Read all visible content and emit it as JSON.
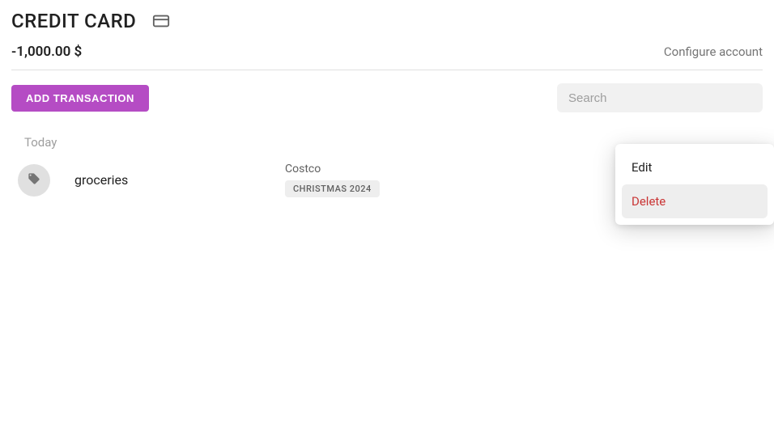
{
  "header": {
    "account_name": "CREDIT CARD",
    "balance": "-1,000.00 $",
    "configure_label": "Configure account"
  },
  "actions": {
    "add_transaction_label": "ADD TRANSACTION",
    "search_placeholder": "Search"
  },
  "transactions": {
    "date_group": "Today",
    "item": {
      "category": "groceries",
      "merchant": "Costco",
      "tag": "CHRISTMAS 2024"
    }
  },
  "context_menu": {
    "edit": "Edit",
    "delete": "Delete"
  }
}
